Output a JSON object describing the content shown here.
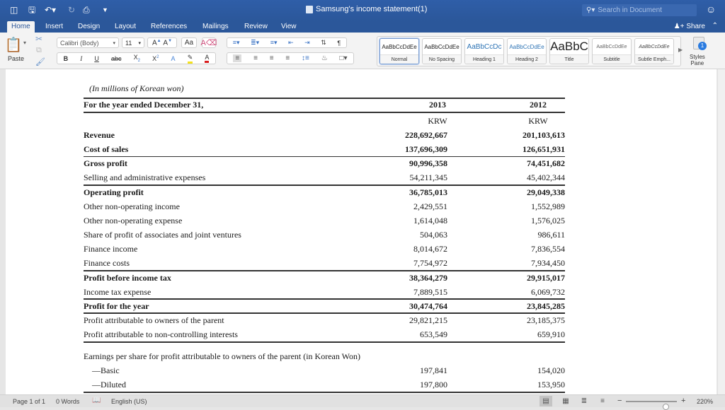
{
  "app": {
    "document_title": "Samsung's income statement(1)",
    "search_placeholder": "Search in Document",
    "share_label": "Share"
  },
  "quick_access": [
    "sidebar-toggle",
    "save",
    "undo",
    "redo",
    "print",
    "customize"
  ],
  "tabs": [
    {
      "label": "Home",
      "active": true
    },
    {
      "label": "Insert"
    },
    {
      "label": "Design"
    },
    {
      "label": "Layout"
    },
    {
      "label": "References"
    },
    {
      "label": "Mailings"
    },
    {
      "label": "Review"
    },
    {
      "label": "View"
    }
  ],
  "ribbon": {
    "paste_label": "Paste",
    "font_name": "Calibri (Body)",
    "font_size": "11",
    "styles": [
      {
        "sample": "AaBbCcDdEe",
        "label": "Normal",
        "selected": true
      },
      {
        "sample": "AaBbCcDdEe",
        "label": "No Spacing"
      },
      {
        "sample": "AaBbCcDc",
        "label": "Heading 1"
      },
      {
        "sample": "AaBbCcDdEe",
        "label": "Heading 2"
      },
      {
        "sample": "AaBbC",
        "label": "Title"
      },
      {
        "sample": "AaBbCcDdEe",
        "label": "Subtitle"
      },
      {
        "sample": "AaBbCcDdEe",
        "label": "Subtle Emph..."
      }
    ],
    "styles_pane_label_1": "Styles",
    "styles_pane_label_2": "Pane"
  },
  "document": {
    "units_note": "(In millions of Korean won)",
    "header_label": "For the year ended December 31,",
    "years": [
      "2013",
      "2012"
    ],
    "currency": [
      "KRW",
      "KRW"
    ],
    "rows": [
      {
        "label": "Revenue",
        "v2013": "228,692,667",
        "v2012": "201,103,613",
        "bold": true
      },
      {
        "label": "Cost of sales",
        "v2013": "137,696,309",
        "v2012": "126,651,931",
        "bold": true
      },
      {
        "label": "Gross profit",
        "v2013": "90,996,358",
        "v2012": "74,451,682",
        "bold": true
      },
      {
        "label": "Selling and administrative expenses",
        "v2013": "54,211,345",
        "v2012": "45,402,344"
      },
      {
        "label": "Operating profit",
        "v2013": "36,785,013",
        "v2012": "29,049,338",
        "bold": true
      },
      {
        "label": "Other non-operating income",
        "v2013": "2,429,551",
        "v2012": "1,552,989"
      },
      {
        "label": "Other non-operating expense",
        "v2013": "1,614,048",
        "v2012": "1,576,025"
      },
      {
        "label": "Share of profit of associates and joint ventures",
        "v2013": "504,063",
        "v2012": "986,611"
      },
      {
        "label": "Finance income",
        "v2013": "8,014,672",
        "v2012": "7,836,554"
      },
      {
        "label": "Finance costs",
        "v2013": "7,754,972",
        "v2012": "7,934,450"
      },
      {
        "label": "Profit before income tax",
        "v2013": "38,364,279",
        "v2012": "29,915,017",
        "bold": true
      },
      {
        "label": "Income tax expense",
        "v2013": "7,889,515",
        "v2012": "6,069,732"
      },
      {
        "label": "Profit for the year",
        "v2013": "30,474,764",
        "v2012": "23,845,285",
        "bold": true
      },
      {
        "label": "Profit attributable to owners of the parent",
        "v2013": "29,821,215",
        "v2012": "23,185,375"
      },
      {
        "label": "Profit attributable to non-controlling interests",
        "v2013": "653,549",
        "v2012": "659,910"
      }
    ],
    "eps_heading": "Earnings per share for profit attributable to owners of the parent (in Korean Won)",
    "eps_rows": [
      {
        "label": "—Basic",
        "v2013": "197,841",
        "v2012": "154,020"
      },
      {
        "label": "—Diluted",
        "v2013": "197,800",
        "v2012": "153,950"
      }
    ]
  },
  "status": {
    "page": "Page 1 of 1",
    "words": "0 Words",
    "language": "English (US)",
    "zoom": "220%",
    "zoom_fraction": 0.78
  }
}
